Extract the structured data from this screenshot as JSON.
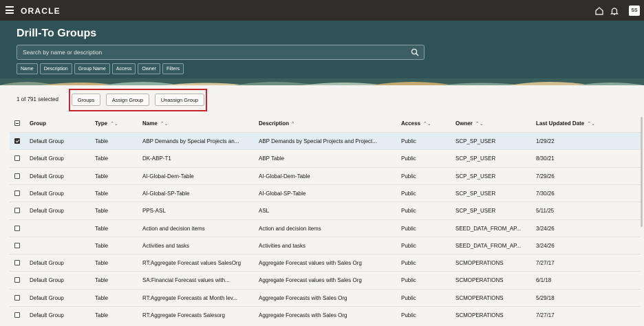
{
  "topbar": {
    "logo": "ORACLE",
    "avatar_initials": "SS",
    "icons": [
      "menu-icon",
      "home-icon",
      "bell-icon"
    ]
  },
  "header": {
    "title": "Drill-To Groups",
    "search_placeholder": "Search by name or description",
    "filter_chips": [
      "Name",
      "Description",
      "Group Name",
      "Access",
      "Owner",
      "Filters"
    ]
  },
  "toolbar": {
    "selected_count": "1 of 791 selected",
    "groups_label": "Groups",
    "assign_label": "Assign Group",
    "unassign_label": "Unassign Group",
    "highlight_color": "#c3272b"
  },
  "table": {
    "columns": {
      "group": "Group",
      "type": "Type",
      "name": "Name",
      "description": "Description",
      "access": "Access",
      "owner": "Owner",
      "last_updated": "Last Updated Date"
    },
    "sort_icons": {
      "sortable": "⌃⌄",
      "ascending": "^"
    },
    "rows": [
      {
        "checked": true,
        "group": "Default Group",
        "type": "Table",
        "name": "ABP Demands by Special Projects an...",
        "description": "ABP Demands by Special Projects and Project...",
        "access": "Public",
        "owner": "SCP_SP_USER",
        "date": "1/29/22"
      },
      {
        "checked": false,
        "group": "Default Group",
        "type": "Table",
        "name": "DK-ABP-T1",
        "description": "ABP Table",
        "access": "Public",
        "owner": "SCP_SP_USER",
        "date": "8/30/21"
      },
      {
        "checked": false,
        "group": "Default Group",
        "type": "Table",
        "name": "AI-Global-Dem-Table",
        "description": "AI-Global-Dem-Table",
        "access": "Public",
        "owner": "SCP_SP_USER",
        "date": "7/29/26"
      },
      {
        "checked": false,
        "group": "Default Group",
        "type": "Table",
        "name": "AI-Global-SP-Table",
        "description": "AI-Global-SP-Table",
        "access": "Public",
        "owner": "SCP_SP_USER",
        "date": "7/30/26"
      },
      {
        "checked": false,
        "group": "Default Group",
        "type": "Table",
        "name": "PPS-ASL",
        "description": "ASL",
        "access": "Public",
        "owner": "SCP_SP_USER",
        "date": "5/11/25"
      },
      {
        "checked": false,
        "group": "",
        "type": "Table",
        "name": "Action and decision items",
        "description": "Action and decision items",
        "access": "Public",
        "owner": "SEED_DATA_FROM_AP...",
        "date": "3/24/26"
      },
      {
        "checked": false,
        "group": "",
        "type": "Table",
        "name": "Activities and tasks",
        "description": "Activities and tasks",
        "access": "Public",
        "owner": "SEED_DATA_FROM_AP...",
        "date": "3/24/26"
      },
      {
        "checked": false,
        "group": "Default Group",
        "type": "Table",
        "name": "RT:Aggregate Forecast values SalesOrg",
        "description": "Aggregate Forecast values with Sales Org",
        "access": "Public",
        "owner": "SCMOPERATIONS",
        "date": "7/27/17"
      },
      {
        "checked": false,
        "group": "Default Group",
        "type": "Table",
        "name": "SA:Financial Forecast values with...",
        "description": "Aggregate Forecast values with Sales Org",
        "access": "Public",
        "owner": "SCMOPERATIONS",
        "date": "6/1/18"
      },
      {
        "checked": false,
        "group": "Default Group",
        "type": "Table",
        "name": "RT:Aggregate Forecasts at Month lev...",
        "description": "Aggregate Forecasts with Sales Org",
        "access": "Public",
        "owner": "SCMOPERATIONS",
        "date": "5/29/18"
      },
      {
        "checked": false,
        "group": "Default Group",
        "type": "Table",
        "name": "RT:Aggregate Forecasts Salesorg",
        "description": "Aggregate Forecasts with Sales Org",
        "access": "Public",
        "owner": "SCMOPERATIONS",
        "date": "7/27/17"
      }
    ]
  }
}
